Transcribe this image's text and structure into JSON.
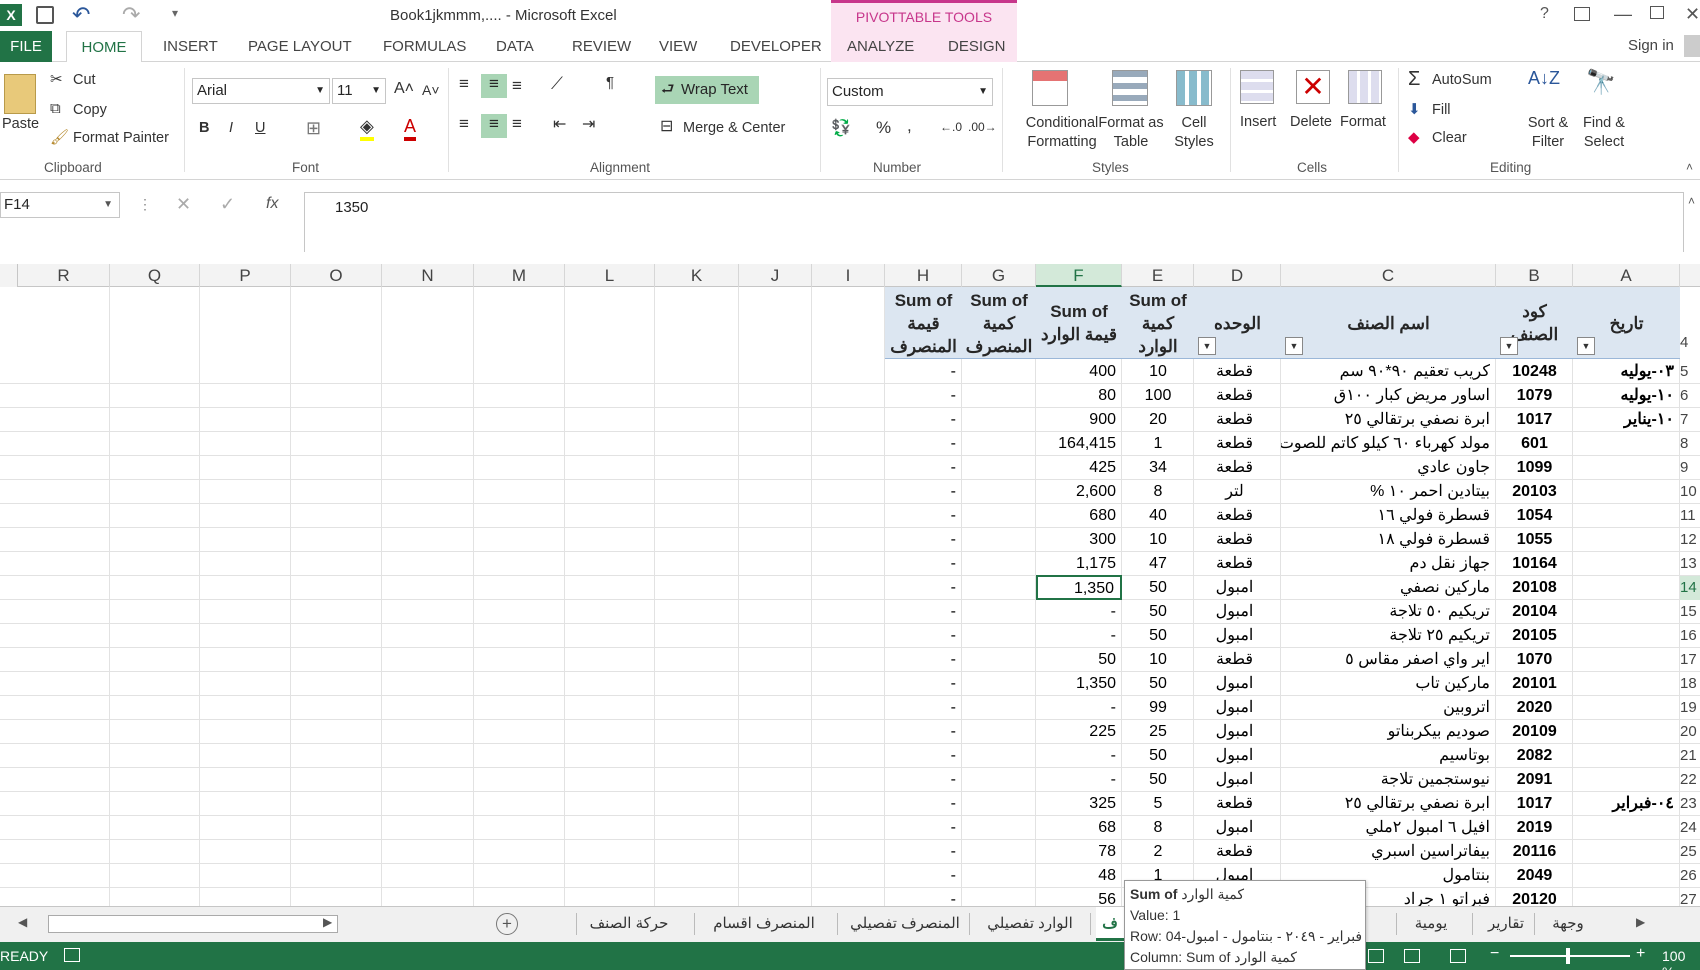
{
  "titlebar": {
    "title": "Book1jkmmm,.... - Microsoft Excel",
    "contextual_tab": "PIVOTTABLE TOOLS",
    "help": "?"
  },
  "tabs": {
    "file": "FILE",
    "home": "HOME",
    "insert": "INSERT",
    "page_layout": "PAGE LAYOUT",
    "formulas": "FORMULAS",
    "data": "DATA",
    "review": "REVIEW",
    "view": "VIEW",
    "developer": "DEVELOPER",
    "analyze": "ANALYZE",
    "design": "DESIGN",
    "sign_in": "Sign in"
  },
  "ribbon": {
    "paste": "Paste",
    "cut": "Cut",
    "copy": "Copy",
    "format_painter": "Format Painter",
    "font_name": "Arial",
    "font_size": "11",
    "bold": "B",
    "italic": "I",
    "underline": "U",
    "wrap_text": "Wrap Text",
    "merge_center": "Merge & Center",
    "number_format": "Custom",
    "conditional_1": "Conditional",
    "conditional_2": "Formatting",
    "format_table_1": "Format as",
    "format_table_2": "Table",
    "cell_styles_1": "Cell",
    "cell_styles_2": "Styles",
    "insert": "Insert",
    "delete": "Delete",
    "format": "Format",
    "autosum": "AutoSum",
    "fill": "Fill",
    "clear": "Clear",
    "sort_1": "Sort &",
    "sort_2": "Filter",
    "find_1": "Find &",
    "find_2": "Select",
    "groups": {
      "clipboard": "Clipboard",
      "font": "Font",
      "alignment": "Alignment",
      "number": "Number",
      "styles": "Styles",
      "cells": "Cells",
      "editing": "Editing"
    }
  },
  "formula_bar": {
    "name_box": "F14",
    "fx": "fx",
    "value": "1350"
  },
  "columns": [
    "R",
    "Q",
    "P",
    "O",
    "N",
    "M",
    "L",
    "K",
    "J",
    "I",
    "H",
    "G",
    "F",
    "E",
    "D",
    "C",
    "B",
    "A"
  ],
  "headers": {
    "H": [
      "Sum of",
      "قيمة",
      "المنصرف"
    ],
    "G": [
      "Sum of",
      "كمية",
      "المنصرف"
    ],
    "F": [
      "Sum of",
      "قيمة الوارد"
    ],
    "E": [
      "Sum of",
      "كمية",
      "الوارد"
    ],
    "D": "الوحده",
    "C": "اسم الصنف",
    "B": [
      "كود",
      "الصنف"
    ],
    "A": "تاريخ",
    "row_num": "4"
  },
  "rows": [
    {
      "rn": "5",
      "date": "٠٣-يوليه",
      "code": "10248",
      "name": "كريب تعقيم ٩٠*٩٠ سم",
      "unit": "قطعة",
      "qty": "10",
      "val": "400",
      "out": "-"
    },
    {
      "rn": "6",
      "date": "١٠-يوليه",
      "code": "1079",
      "name": "اساور مريض كبار ١٠٠ق",
      "unit": "قطعة",
      "qty": "100",
      "val": "80",
      "out": "-"
    },
    {
      "rn": "7",
      "date": "١٠-يناير",
      "code": "1017",
      "name": "ابرة نصفي برتقالي ٢٥",
      "unit": "قطعة",
      "qty": "20",
      "val": "900",
      "out": "-"
    },
    {
      "rn": "8",
      "date": "",
      "code": "601",
      "name": "مولد كهرباء ٦٠ كيلو كاتم للصوت",
      "unit": "قطعة",
      "qty": "1",
      "val": "164,415",
      "out": "-"
    },
    {
      "rn": "9",
      "date": "",
      "code": "1099",
      "name": "جاون عادي",
      "unit": "قطعة",
      "qty": "34",
      "val": "425",
      "out": "-"
    },
    {
      "rn": "10",
      "date": "",
      "code": "20103",
      "name": "بيتادين احمر ١٠ %",
      "unit": "لتر",
      "qty": "8",
      "val": "2,600",
      "out": "-"
    },
    {
      "rn": "11",
      "date": "",
      "code": "1054",
      "name": "قسطرة فولي ١٦",
      "unit": "قطعة",
      "qty": "40",
      "val": "680",
      "out": "-"
    },
    {
      "rn": "12",
      "date": "",
      "code": "1055",
      "name": "قسطرة فولي ١٨",
      "unit": "قطعة",
      "qty": "10",
      "val": "300",
      "out": "-"
    },
    {
      "rn": "13",
      "date": "",
      "code": "10164",
      "name": "جهاز نقل دم",
      "unit": "قطعة",
      "qty": "47",
      "val": "1,175",
      "out": "-"
    },
    {
      "rn": "14",
      "date": "",
      "code": "20108",
      "name": "ماركين نصفي",
      "unit": "امبول",
      "qty": "50",
      "val": "1,350",
      "out": "-"
    },
    {
      "rn": "15",
      "date": "",
      "code": "20104",
      "name": "تريكيم ٥٠ تلاجة",
      "unit": "امبول",
      "qty": "50",
      "val": "-",
      "out": "-"
    },
    {
      "rn": "16",
      "date": "",
      "code": "20105",
      "name": "تريكيم ٢٥ تلاجة",
      "unit": "امبول",
      "qty": "50",
      "val": "-",
      "out": "-"
    },
    {
      "rn": "17",
      "date": "",
      "code": "1070",
      "name": "اير واي اصفر مقاس ٥",
      "unit": "قطعة",
      "qty": "10",
      "val": "50",
      "out": "-"
    },
    {
      "rn": "18",
      "date": "",
      "code": "20101",
      "name": "ماركين تاب",
      "unit": "امبول",
      "qty": "50",
      "val": "1,350",
      "out": "-"
    },
    {
      "rn": "19",
      "date": "",
      "code": "2020",
      "name": "اتروبين",
      "unit": "امبول",
      "qty": "99",
      "val": "-",
      "out": "-"
    },
    {
      "rn": "20",
      "date": "",
      "code": "20109",
      "name": "صوديم بيكربناتو",
      "unit": "امبول",
      "qty": "25",
      "val": "225",
      "out": "-"
    },
    {
      "rn": "21",
      "date": "",
      "code": "2082",
      "name": "بوتاسيم",
      "unit": "امبول",
      "qty": "50",
      "val": "-",
      "out": "-"
    },
    {
      "rn": "22",
      "date": "",
      "code": "2091",
      "name": "نيوستجمين تلاجة",
      "unit": "امبول",
      "qty": "50",
      "val": "-",
      "out": "-"
    },
    {
      "rn": "23",
      "date": "٠٤-فبراير",
      "code": "1017",
      "name": "ابرة نصفي برتقالي ٢٥",
      "unit": "قطعة",
      "qty": "5",
      "val": "325",
      "out": "-"
    },
    {
      "rn": "24",
      "date": "",
      "code": "2019",
      "name": "افيل ٦ امبول ٢ملي",
      "unit": "امبول",
      "qty": "8",
      "val": "68",
      "out": "-"
    },
    {
      "rn": "25",
      "date": "",
      "code": "20116",
      "name": "بيفاتراسين اسبري",
      "unit": "قطعة",
      "qty": "2",
      "val": "78",
      "out": "-"
    },
    {
      "rn": "26",
      "date": "",
      "code": "2049",
      "name": "بنتامول",
      "unit": "امبول",
      "qty": "1",
      "val": "48",
      "out": "-"
    },
    {
      "rn": "27",
      "date": "",
      "code": "20120",
      "name": "فبراتو ١ جراد",
      "unit": "",
      "qty": "",
      "val": "56",
      "out": "-"
    }
  ],
  "sheet_tabs": [
    "وجهة",
    "تقارير",
    "يومية",
    "ف",
    "الوارد تفصيلي",
    "المنصرف تفصيلي",
    "المنصرف اقسام",
    "حركة الصنف"
  ],
  "tooltip": {
    "line1_bold": "Sum of",
    "line1_rest": "كمية الوارد",
    "line2": "Value: 1",
    "line3": "Row: 04-فبراير - ٢٠٤٩ - بنتامول - امبول",
    "line4": "Column: Sum of كمية الوارد"
  },
  "status": {
    "ready": "READY",
    "zoom": "100 %"
  },
  "colors": {
    "excel_green": "#217346",
    "pivot_header": "#dce6f1",
    "selected_tab": "#e1f0e6",
    "context_tab": "#fbe4f1"
  }
}
